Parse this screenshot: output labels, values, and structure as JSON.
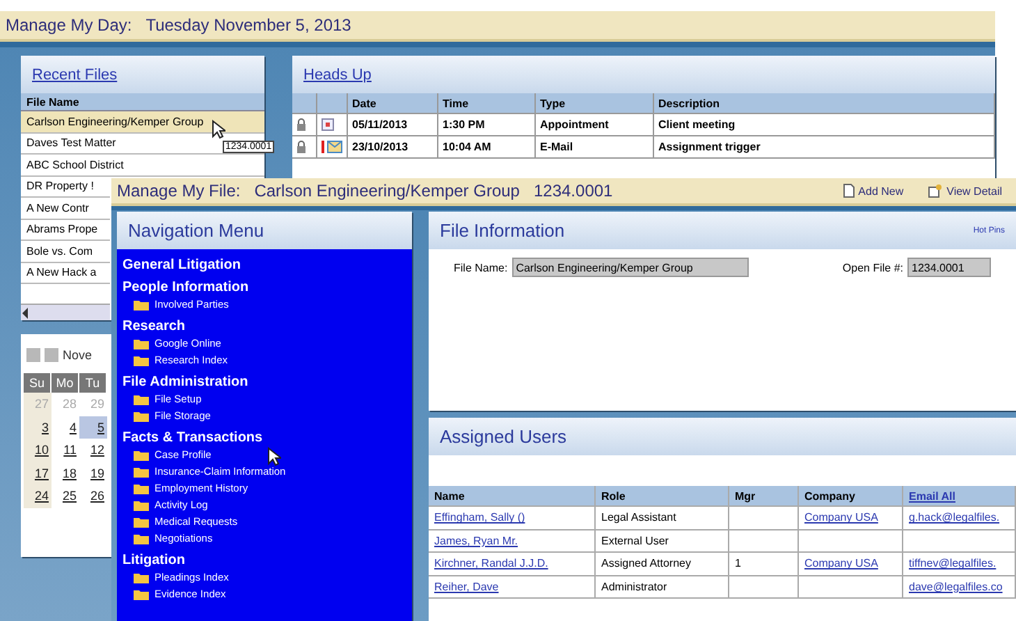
{
  "day_window": {
    "title": "Manage My Day:",
    "date": "Tuesday November 5, 2013"
  },
  "recent_files": {
    "title": "Recent Files",
    "column": "File Name",
    "tooltip": "1234.0001",
    "rows": [
      {
        "name": "Carlson Engineering/Kemper Group",
        "selected": true
      },
      {
        "name": "Daves Test Matter",
        "selected": false
      },
      {
        "name": "ABC School District",
        "selected": false
      },
      {
        "name": "DR Property !",
        "selected": false
      },
      {
        "name": "A New Contr",
        "selected": false
      },
      {
        "name": "Abrams Prope",
        "selected": false
      },
      {
        "name": "Bole vs. Com",
        "selected": false
      },
      {
        "name": "A New Hack a",
        "selected": false
      }
    ]
  },
  "calendar": {
    "month": "Nove",
    "weekdays": [
      "Su",
      "Mo",
      "Tu"
    ],
    "weeks": [
      [
        {
          "day": "27",
          "other_month": true,
          "selected": false
        },
        {
          "day": "28",
          "other_month": true,
          "selected": false
        },
        {
          "day": "29",
          "other_month": true,
          "selected": false
        }
      ],
      [
        {
          "day": "3",
          "other_month": false,
          "selected": false
        },
        {
          "day": "4",
          "other_month": false,
          "selected": false
        },
        {
          "day": "5",
          "other_month": false,
          "selected": true
        }
      ],
      [
        {
          "day": "10",
          "other_month": false,
          "selected": false
        },
        {
          "day": "11",
          "other_month": false,
          "selected": false
        },
        {
          "day": "12",
          "other_month": false,
          "selected": false
        }
      ],
      [
        {
          "day": "17",
          "other_month": false,
          "selected": false
        },
        {
          "day": "18",
          "other_month": false,
          "selected": false
        },
        {
          "day": "19",
          "other_month": false,
          "selected": false
        }
      ],
      [
        {
          "day": "24",
          "other_month": false,
          "selected": false
        },
        {
          "day": "25",
          "other_month": false,
          "selected": false
        },
        {
          "day": "26",
          "other_month": false,
          "selected": false
        }
      ]
    ]
  },
  "heads_up": {
    "title": "Heads Up",
    "columns": [
      "Date",
      "Time",
      "Type",
      "Description"
    ],
    "rows": [
      {
        "kind": "appointment",
        "flagged": false,
        "date": "05/11/2013",
        "time": "1:30 PM",
        "type": "Appointment",
        "description": "Client meeting"
      },
      {
        "kind": "email",
        "flagged": true,
        "date": "23/10/2013",
        "time": "10:04 AM",
        "type": "E-Mail",
        "description": "Assignment trigger"
      }
    ]
  },
  "file_window": {
    "title": "Manage My File:",
    "file_name": "Carlson Engineering/Kemper Group",
    "file_number": "1234.0001",
    "actions": [
      {
        "kind": "add",
        "label": "Add New"
      },
      {
        "kind": "detail",
        "label": "View Detail"
      }
    ]
  },
  "navigation": {
    "title": "Navigation Menu",
    "sections": [
      {
        "label": "General Litigation"
      },
      {
        "label": "People Information",
        "children": [
          "Involved Parties"
        ]
      },
      {
        "label": "Research",
        "children": [
          "Google Online",
          "Research Index"
        ]
      },
      {
        "label": "File Administration",
        "children": [
          "File Setup",
          "File Storage"
        ]
      },
      {
        "label": "Facts & Transactions",
        "children": [
          "Case Profile",
          "Insurance-Claim Information",
          "Employment History",
          "Activity Log",
          "Medical Requests",
          "Negotiations"
        ]
      },
      {
        "label": "Litigation",
        "children": [
          "Pleadings Index",
          "Evidence Index"
        ]
      }
    ]
  },
  "file_information": {
    "title": "File Information",
    "link": "Hot Pins",
    "fields": [
      {
        "label": "File Name:",
        "value": "Carlson Engineering/Kemper Group"
      },
      {
        "label": "Open File #:",
        "value": "1234.0001"
      }
    ]
  },
  "assigned_users": {
    "title": "Assigned Users",
    "columns": [
      "Name",
      "Role",
      "Mgr",
      "Company",
      "Email All"
    ],
    "rows": [
      {
        "name": "Effingham, Sally ()",
        "role": "Legal Assistant",
        "company": "Company USA",
        "email": "g.hack@legalfiles."
      },
      {
        "name": "James, Ryan Mr.",
        "role": "External User"
      },
      {
        "name": "Kirchner, Randal J.J.D.",
        "role": "Assigned Attorney",
        "mgr": "1",
        "company": "Company USA",
        "email": "tiffnev@legalfiles."
      },
      {
        "name": "Reiher, Dave",
        "role": "Administrator",
        "email": "dave@legalfiles.co"
      }
    ]
  }
}
